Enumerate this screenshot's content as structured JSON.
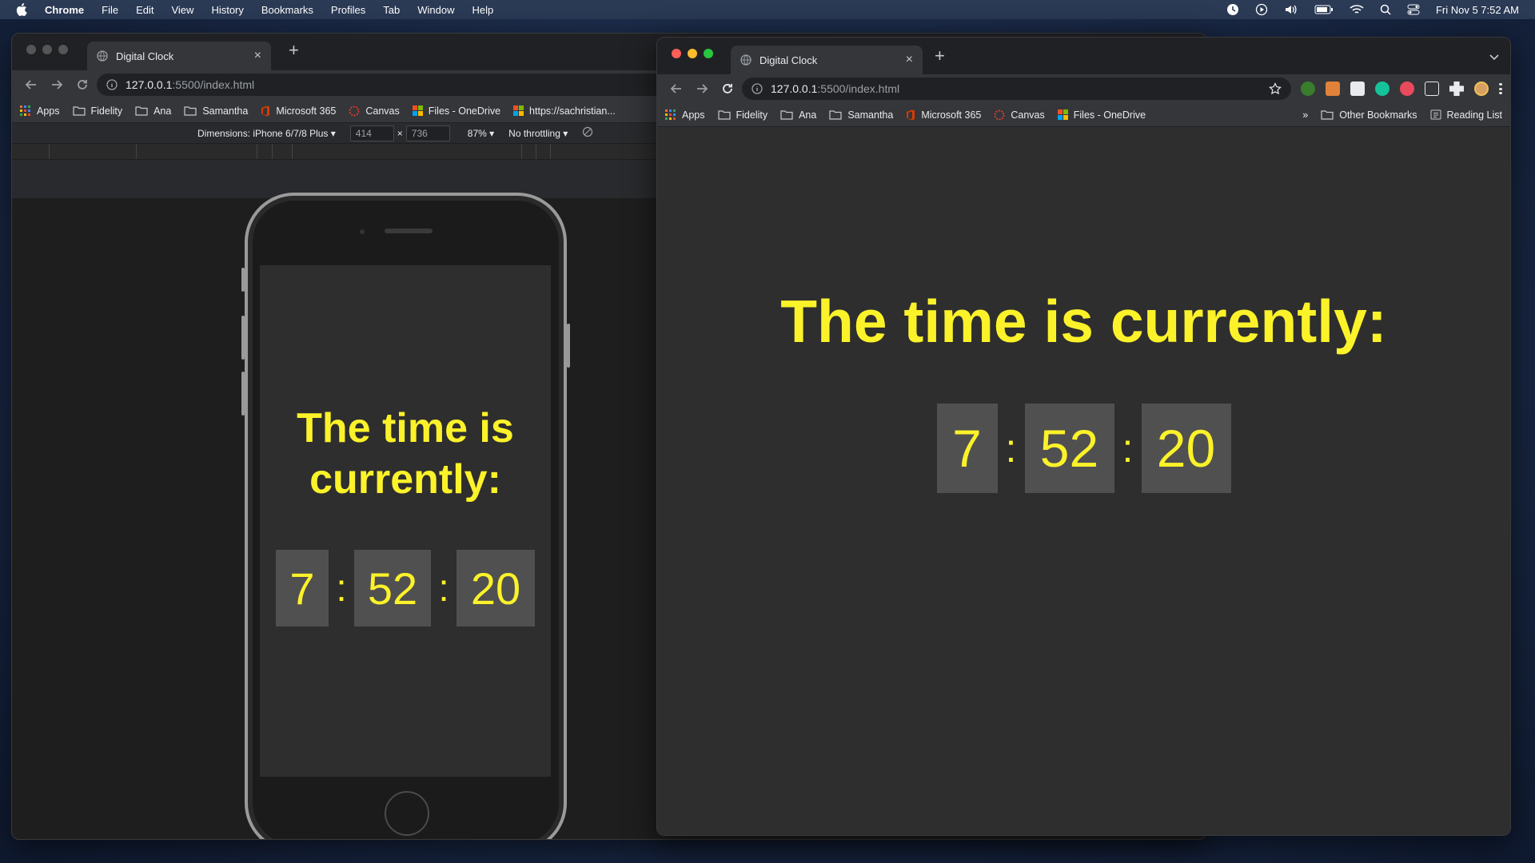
{
  "menubar": {
    "app": "Chrome",
    "items": [
      "File",
      "Edit",
      "View",
      "History",
      "Bookmarks",
      "Profiles",
      "Tab",
      "Window",
      "Help"
    ],
    "datetime": "Fri Nov 5  7:52 AM"
  },
  "left_window": {
    "tab_title": "Digital Clock",
    "url_host": "127.0.0.1",
    "url_path": ":5500/index.html",
    "bookmarks": [
      "Apps",
      "Fidelity",
      "Ana",
      "Samantha",
      "Microsoft 365",
      "Canvas",
      "Files - OneDrive",
      "https://sachristian..."
    ],
    "device": {
      "dimensions_label": "Dimensions: iPhone 6/7/8 Plus ▾",
      "width": "414",
      "times": "×",
      "height": "736",
      "zoom": "87% ▾",
      "throttling": "No throttling ▾"
    },
    "page": {
      "heading": "The time is currently:",
      "hours": "7",
      "minutes": "52",
      "seconds": "20",
      "separator": ":"
    }
  },
  "right_window": {
    "tab_title": "Digital Clock",
    "url_host": "127.0.0.1",
    "url_path": ":5500/index.html",
    "bookmarks": [
      "Apps",
      "Fidelity",
      "Ana",
      "Samantha",
      "Microsoft 365",
      "Canvas",
      "Files - OneDrive"
    ],
    "overflow": "»",
    "other_bookmarks": "Other Bookmarks",
    "reading_list": "Reading List",
    "page": {
      "heading": "The time is currently:",
      "hours": "7",
      "minutes": "52",
      "seconds": "20",
      "separator": ":"
    }
  },
  "colors": {
    "clock_yellow": "#fbf22a",
    "digit_box": "#505050",
    "page_bg": "#2e2e2e",
    "close": "#ff5f57",
    "minimize": "#febc2e",
    "zoom": "#28c840"
  }
}
